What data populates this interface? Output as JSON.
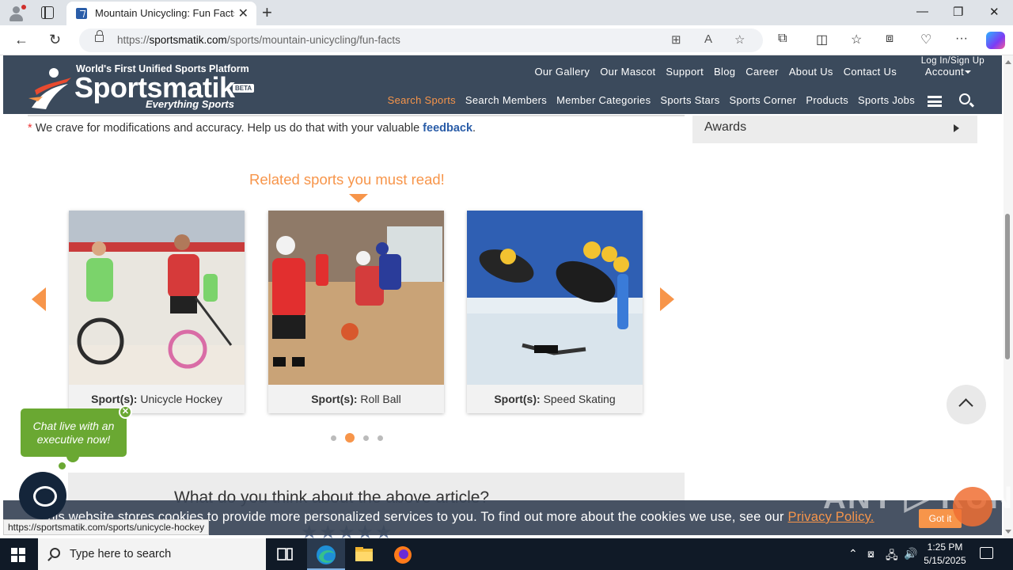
{
  "browser": {
    "tab_title": "Mountain Unicycling: Fun Facts,",
    "url_prefix": "https://",
    "url_domain": "sportsmatik.com",
    "url_path": "/sports/mountain-unicycling/fun-facts",
    "status_url": "https://sportsmatik.com/sports/unicycle-hockey"
  },
  "header": {
    "tagline": "World's First Unified Sports Platform",
    "brand": "Sportsmatik",
    "beta": "BETA",
    "subtitle": "Everything Sports",
    "top_nav": [
      "Our Gallery",
      "Our Mascot",
      "Support",
      "Blog",
      "Career",
      "About Us",
      "Contact Us"
    ],
    "login": "Log In/Sign Up",
    "account": "Account",
    "main_nav": [
      "Search Sports",
      "Search Members",
      "Member Categories",
      "Sports Stars",
      "Sports Corner",
      "Products",
      "Sports Jobs"
    ],
    "active_nav": "Search Sports"
  },
  "content": {
    "feedback_prefix": "We crave for modifications and accuracy. Help us do that with your valuable",
    "feedback_link": "feedback",
    "feedback_suffix": ".",
    "sidebar_item": "Awards",
    "related_title": "Related sports you must read!",
    "card_label": "Sport(s):",
    "cards": [
      {
        "sport": "Unicycle Hockey"
      },
      {
        "sport": "Roll Ball"
      },
      {
        "sport": "Speed Skating"
      }
    ],
    "opinion_title": "What do you think about the above article?"
  },
  "chat": {
    "line1": "Chat live with an",
    "line2": "executive now!"
  },
  "cookie": {
    "text": "This website stores cookies to provide more personalized services to you. To find out more about the cookies we use, see our",
    "policy_link": "Privacy Policy.",
    "button": "Got it"
  },
  "taskbar": {
    "search_placeholder": "Type here to search",
    "time": "1:25 PM",
    "date": "5/15/2025"
  },
  "colors": {
    "accent": "#f7954a",
    "header_bg": "#3b4a5c",
    "link": "#2a5da8",
    "chat_green": "#6aa832"
  }
}
